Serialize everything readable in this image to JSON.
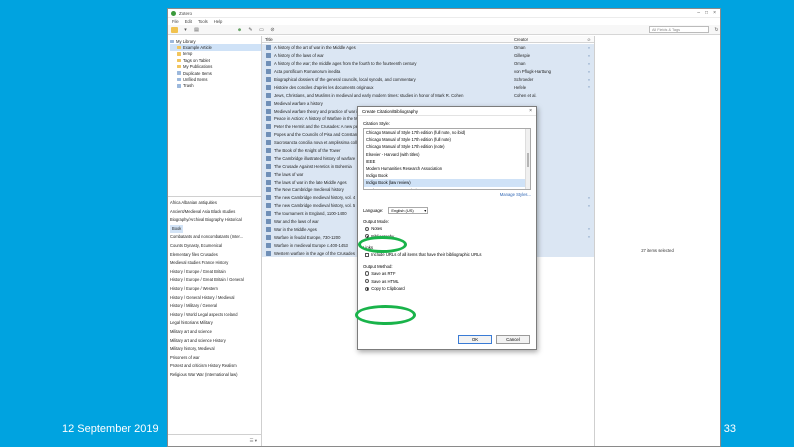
{
  "slide": {
    "date": "12 September 2019",
    "page_number": "33"
  },
  "window": {
    "title": "Zotero",
    "menu": [
      "File",
      "Edit",
      "Tools",
      "Help"
    ],
    "search_placeholder": "All Fields & Tags",
    "controls": [
      "–",
      "□",
      "×"
    ]
  },
  "collections": [
    {
      "label": "My Library",
      "type": "root",
      "selected": false
    },
    {
      "label": "Example Article",
      "type": "child",
      "selected": true
    },
    {
      "label": "temp",
      "type": "child",
      "selected": false
    },
    {
      "label": "Tags on Tablet",
      "type": "child",
      "selected": false
    },
    {
      "label": "My Publications",
      "type": "child",
      "selected": false
    },
    {
      "label": "Duplicate Items",
      "type": "child",
      "selected": false
    },
    {
      "label": "Unfiled Items",
      "type": "child",
      "selected": false
    },
    {
      "label": "Trash",
      "type": "child",
      "selected": false
    }
  ],
  "tags": [
    {
      "label": "Africa   Albanian   antiquities",
      "hi": false
    },
    {
      "label": "Ancient/Medieval  Asia   Black studies",
      "hi": false
    },
    {
      "label": "Biography/Archival  Biography  Historical",
      "hi": false
    },
    {
      "label": "Book",
      "hi": true
    },
    {
      "label": "Combatants and noncombatants (Inter...",
      "hi": false
    },
    {
      "label": "Counts  Dynasty, Ecumenical",
      "hi": false
    },
    {
      "label": "Elementary files   Crusades",
      "hi": false
    },
    {
      "label": "Medieval studies   France   History",
      "hi": false
    },
    {
      "label": "History / Europe / Great Britain",
      "hi": false
    },
    {
      "label": "History / Europe / Great Britain / General",
      "hi": false
    },
    {
      "label": "History / Europe / Western",
      "hi": false
    },
    {
      "label": "History / General   History / Medieval",
      "hi": false
    },
    {
      "label": "History / Military / General",
      "hi": false
    },
    {
      "label": "History / World   Legal aspects   Iceland",
      "hi": false
    },
    {
      "label": "Legal historians   Military",
      "hi": false
    },
    {
      "label": "Military art and science",
      "hi": false
    },
    {
      "label": "Military art and science   History",
      "hi": false
    },
    {
      "label": "Military history, Medieval",
      "hi": false
    },
    {
      "label": "Prisoners of war",
      "hi": false
    },
    {
      "label": "Protest and criticism   History   Realism",
      "hi": false
    },
    {
      "label": "Religious   War   War (International law)",
      "hi": false
    }
  ],
  "items_table": {
    "headers": {
      "title": "Title",
      "creator": "Creator"
    },
    "rows": [
      {
        "title": "A history of the art of war in the Middle Ages",
        "creator": "Oman",
        "att": "●"
      },
      {
        "title": "A history of the laws of war",
        "creator": "Gillespie",
        "att": "●"
      },
      {
        "title": "A history of the war; the middle ages from the fourth to the fourteenth century",
        "creator": "Oman",
        "att": "●"
      },
      {
        "title": "Acta pontificum Romanorum inedita",
        "creator": "von Pflugk-Harttung",
        "att": "●"
      },
      {
        "title": "Biographical dossiers of the general councils, local synods, and commentary",
        "creator": "Schroeder",
        "att": "●"
      },
      {
        "title": "Histoire des conciles d'après les documents originaux",
        "creator": "Hefele",
        "att": "●"
      },
      {
        "title": "Jews, Christians, and Muslims in medieval and early modern times: studies in honor of Mark R. Cohen",
        "creator": "Cohen et al.",
        "att": ""
      },
      {
        "title": "Medieval warfare a history",
        "creator": "",
        "att": ""
      },
      {
        "title": "Medieval warfare theory and practice of war in Europe",
        "creator": "",
        "att": ""
      },
      {
        "title": "Peace in Action: A history of Warfare in the Medieval period",
        "creator": "",
        "att": ""
      },
      {
        "title": "Peter the Hermit and the Crusades: A new perspective",
        "creator": "",
        "att": ""
      },
      {
        "title": "Popes and the Councils of Pisa and Constance",
        "creator": "",
        "att": ""
      },
      {
        "title": "Sacrosancta concilia nova et amplissima collectio",
        "creator": "",
        "att": ""
      },
      {
        "title": "The Book of the Knight of the Tower",
        "creator": "",
        "att": ""
      },
      {
        "title": "The Cambridge illustrated history of warfare",
        "creator": "",
        "att": ""
      },
      {
        "title": "The Crusade Against Heretics in Bohemia",
        "creator": "",
        "att": ""
      },
      {
        "title": "The laws of war",
        "creator": "",
        "att": ""
      },
      {
        "title": "The laws of war in the late Middle Ages",
        "creator": "",
        "att": ""
      },
      {
        "title": "The New Cambridge medieval history",
        "creator": "",
        "att": ""
      },
      {
        "title": "The new Cambridge medieval history, vol. 4",
        "creator": "Riley-Smith",
        "att": "●"
      },
      {
        "title": "The new Cambridge medieval history, vol. 5",
        "creator": "Riley-Smith",
        "att": "●"
      },
      {
        "title": "The tournament in England, 1100-1400",
        "creator": "",
        "att": ""
      },
      {
        "title": "War and the laws of war",
        "creator": "",
        "att": ""
      },
      {
        "title": "War in the Middle Ages",
        "creator": "",
        "att": "●"
      },
      {
        "title": "Warfare in feudal Europe, 730-1200",
        "creator": "",
        "att": "●"
      },
      {
        "title": "Warfare in medieval Europe c.400-1453",
        "creator": "Anderson",
        "att": ""
      },
      {
        "title": "Western warfare in the age of the Crusades",
        "creator": "",
        "att": ""
      }
    ]
  },
  "right_pane": {
    "status": "27 items selected"
  },
  "dialog": {
    "title": "Create Citation/Bibliography",
    "citation_style_label": "Citation Style:",
    "styles": [
      {
        "label": "Chicago Manual of Style 17th edition (full note, no ibid)",
        "selected": false
      },
      {
        "label": "Chicago Manual of Style 17th edition (full note)",
        "selected": false
      },
      {
        "label": "Chicago Manual of Style 17th edition (note)",
        "selected": false
      },
      {
        "label": "Elsevier - Harvard (with titles)",
        "selected": false
      },
      {
        "label": "IEEE",
        "selected": false
      },
      {
        "label": "Modern Humanities Research Association",
        "selected": false
      },
      {
        "label": "Indigo Book",
        "selected": false
      },
      {
        "label": "Indigo Book (law review)",
        "selected": true
      },
      {
        "label": "Modern Language Association",
        "selected": false
      }
    ],
    "manage_styles": "Manage Styles...",
    "language_label": "Language:",
    "language_value": "English (US)",
    "output_mode_label": "Output Mode:",
    "output_modes": [
      {
        "label": "Notes",
        "checked": false
      },
      {
        "label": "Bibliography",
        "checked": true
      }
    ],
    "links_label": "Links",
    "include_urls": "Include URLs of all items that have their bibliographic URLs",
    "output_method_label": "Output Method:",
    "output_methods": [
      {
        "label": "Save as RTF",
        "checked": false
      },
      {
        "label": "Save as HTML",
        "checked": false
      },
      {
        "label": "Copy to Clipboard",
        "checked": true
      }
    ],
    "ok_label": "OK",
    "cancel_label": "Cancel"
  },
  "accent_colors": {
    "slide_background": "#00a3e0",
    "highlight_ring": "#19b34a",
    "selection": "#cfe2f7"
  }
}
